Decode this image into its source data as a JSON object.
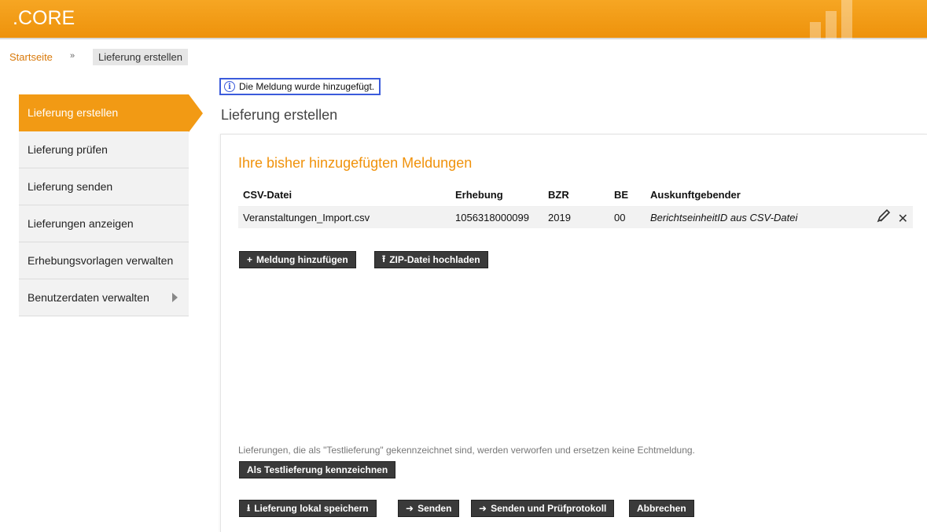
{
  "header": {
    "brand": ".CORE"
  },
  "breadcrumb": {
    "home": "Startseite",
    "separator": "»",
    "current": "Lieferung erstellen"
  },
  "sidebar": {
    "items": [
      {
        "label": "Lieferung erstellen",
        "active": true
      },
      {
        "label": "Lieferung prüfen"
      },
      {
        "label": "Lieferung senden"
      },
      {
        "label": "Lieferungen anzeigen"
      },
      {
        "label": "Erhebungsvorlagen verwalten"
      },
      {
        "label": "Benutzerdaten verwalten",
        "has_submenu": true
      }
    ]
  },
  "notice": {
    "text": "Die Meldung wurde hinzugefügt.",
    "icon": "info-icon"
  },
  "page": {
    "title": "Lieferung erstellen"
  },
  "messages": {
    "title": "Ihre bisher hinzugefügten Meldungen",
    "columns": [
      "CSV-Datei",
      "Erhebung",
      "BZR",
      "BE",
      "Auskunftgebender"
    ],
    "rows": [
      {
        "csv": "Veranstaltungen_Import.csv",
        "erhebung": "1056318000099",
        "bzr": "2019",
        "be": "00",
        "auskunftgebender": "BerichtseinheitID aus CSV-Datei"
      }
    ]
  },
  "buttons": {
    "add_message": "Meldung hinzufügen",
    "upload_zip": "ZIP-Datei hochladen",
    "mark_test": "Als Testlieferung kennzeichnen",
    "save_local": "Lieferung lokal speichern",
    "send": "Senden",
    "send_protocol": "Senden und Prüfprotokoll",
    "cancel": "Abbrechen"
  },
  "hint": "Lieferungen, die als \"Testlieferung\" gekennzeichnet sind, werden verworfen und ersetzen keine Echtmeldung.",
  "colors": {
    "accent": "#f29a14",
    "header": "#ee920b",
    "button": "#3a3a3a",
    "notice_border": "#3b5bdb"
  }
}
